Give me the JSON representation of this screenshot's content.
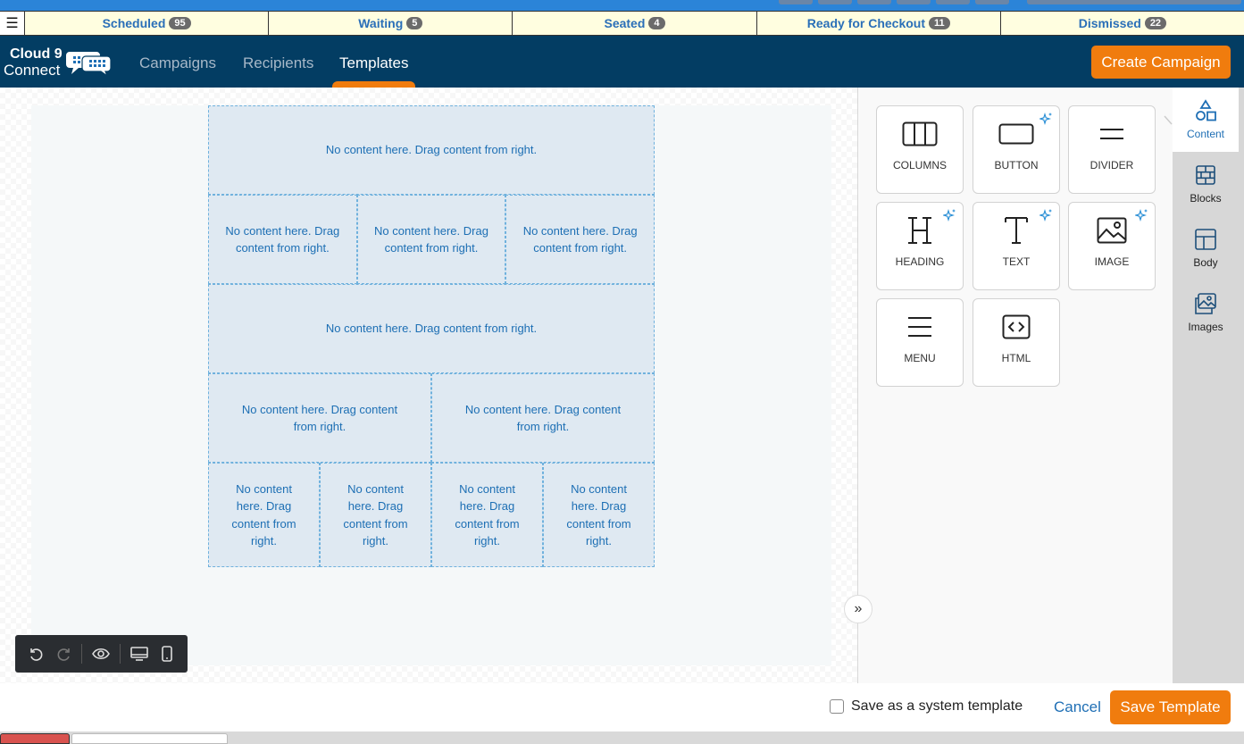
{
  "status_tabs": [
    {
      "label": "Scheduled",
      "count": "95"
    },
    {
      "label": "Waiting",
      "count": "5"
    },
    {
      "label": "Seated",
      "count": "4"
    },
    {
      "label": "Ready for Checkout",
      "count": "11"
    },
    {
      "label": "Dismissed",
      "count": "22"
    }
  ],
  "menu_icon": "hamburger-icon",
  "logo": {
    "line1": "Cloud 9",
    "line2": "Connect"
  },
  "nav": {
    "tabs": [
      "Campaigns",
      "Recipients",
      "Templates"
    ],
    "active": "Templates",
    "create_label": "Create Campaign"
  },
  "canvas": {
    "placeholder": "No content here. Drag content from right.",
    "rows": [
      1,
      3,
      1,
      2,
      4
    ]
  },
  "tools": [
    {
      "label": "COLUMNS",
      "icon": "columns-icon",
      "ai": false
    },
    {
      "label": "BUTTON",
      "icon": "button-icon",
      "ai": true
    },
    {
      "label": "DIVIDER",
      "icon": "divider-icon",
      "ai": false
    },
    {
      "label": "HEADING",
      "icon": "heading-icon",
      "ai": true
    },
    {
      "label": "TEXT",
      "icon": "text-icon",
      "ai": true
    },
    {
      "label": "IMAGE",
      "icon": "image-icon",
      "ai": true
    },
    {
      "label": "MENU",
      "icon": "menu-icon",
      "ai": false
    },
    {
      "label": "HTML",
      "icon": "html-icon",
      "ai": false
    }
  ],
  "side_tabs": [
    {
      "label": "Content",
      "icon": "shapes-icon",
      "active": true
    },
    {
      "label": "Blocks",
      "icon": "blocks-icon",
      "active": false
    },
    {
      "label": "Body",
      "icon": "layout-icon",
      "active": false
    },
    {
      "label": "Images",
      "icon": "images-icon",
      "active": false
    }
  ],
  "footer": {
    "system_template_label": "Save as a system template",
    "system_template_checked": false,
    "cancel_label": "Cancel",
    "save_label": "Save Template"
  },
  "colors": {
    "accent": "#f07c0e",
    "nav_bg": "#033d63",
    "link": "#1f6fb5",
    "status_bg": "#fffee0",
    "top_strip": "#2b84d8"
  }
}
